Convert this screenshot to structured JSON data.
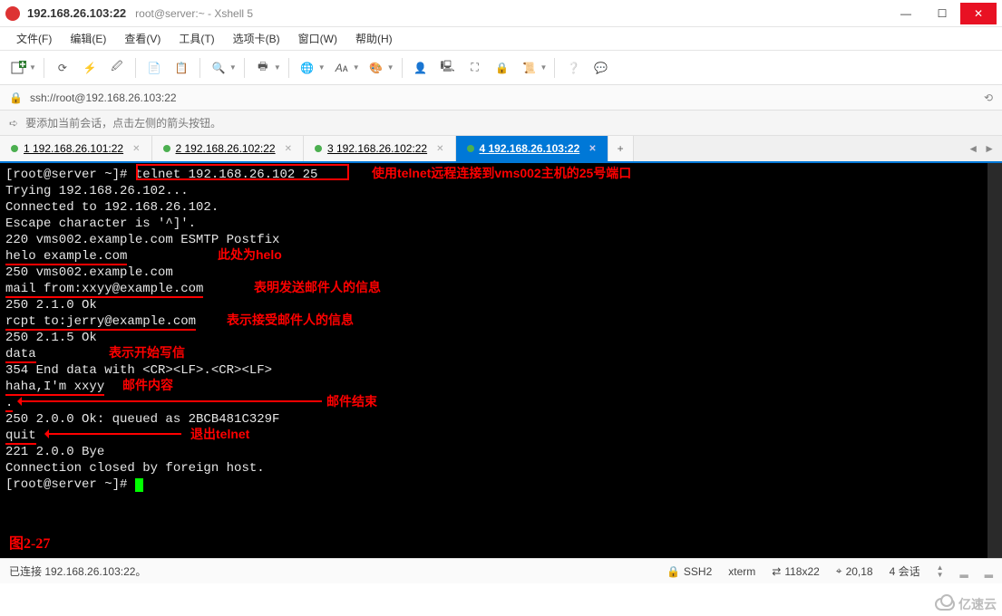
{
  "window": {
    "title_host": "192.168.26.103:22",
    "title_sub": "root@server:~ - Xshell 5"
  },
  "menu": [
    "文件(F)",
    "编辑(E)",
    "查看(V)",
    "工具(T)",
    "选项卡(B)",
    "窗口(W)",
    "帮助(H)"
  ],
  "address": "ssh://root@192.168.26.103:22",
  "hint": "要添加当前会话，点击左侧的箭头按钮。",
  "tabs": [
    {
      "label": "1 192.168.26.101:22",
      "active": false
    },
    {
      "label": "2 192.168.26.102:22",
      "active": false
    },
    {
      "label": "3 192.168.26.102:22",
      "active": false
    },
    {
      "label": "4 192.168.26.103:22",
      "active": true
    }
  ],
  "terminal": {
    "prompt": "[root@server ~]# ",
    "cmd": "telnet 192.168.26.102 25",
    "lines": [
      "Trying 192.168.26.102...",
      "Connected to 192.168.26.102.",
      "Escape character is '^]'.",
      "220 vms002.example.com ESMTP Postfix",
      "helo example.com",
      "250 vms002.example.com",
      "mail from:xxyy@example.com",
      "250 2.1.0 Ok",
      "rcpt to:jerry@example.com",
      "250 2.1.5 Ok",
      "data",
      "354 End data with <CR><LF>.<CR><LF>",
      "haha,I'm xxyy",
      ".",
      "250 2.0.0 Ok: queued as 2BCB481C329F",
      "quit",
      "221 2.0.0 Bye",
      "Connection closed by foreign host.",
      "[root@server ~]# "
    ],
    "annotations": {
      "a1": "使用telnet远程连接到vms002主机的25号端口",
      "a2": "此处为helo",
      "a3": "表明发送邮件人的信息",
      "a4": "表示接受邮件人的信息",
      "a5": "表示开始写信",
      "a6": "邮件内容",
      "a7": "邮件结束",
      "a8": "退出telnet",
      "figlabel": "图2-27"
    }
  },
  "status": {
    "left": "已连接 192.168.26.103:22。",
    "ssh": "SSH2",
    "term": "xterm",
    "size": "118x22",
    "pos": "20,18",
    "sessions": "4 会话"
  },
  "watermark": "亿速云"
}
